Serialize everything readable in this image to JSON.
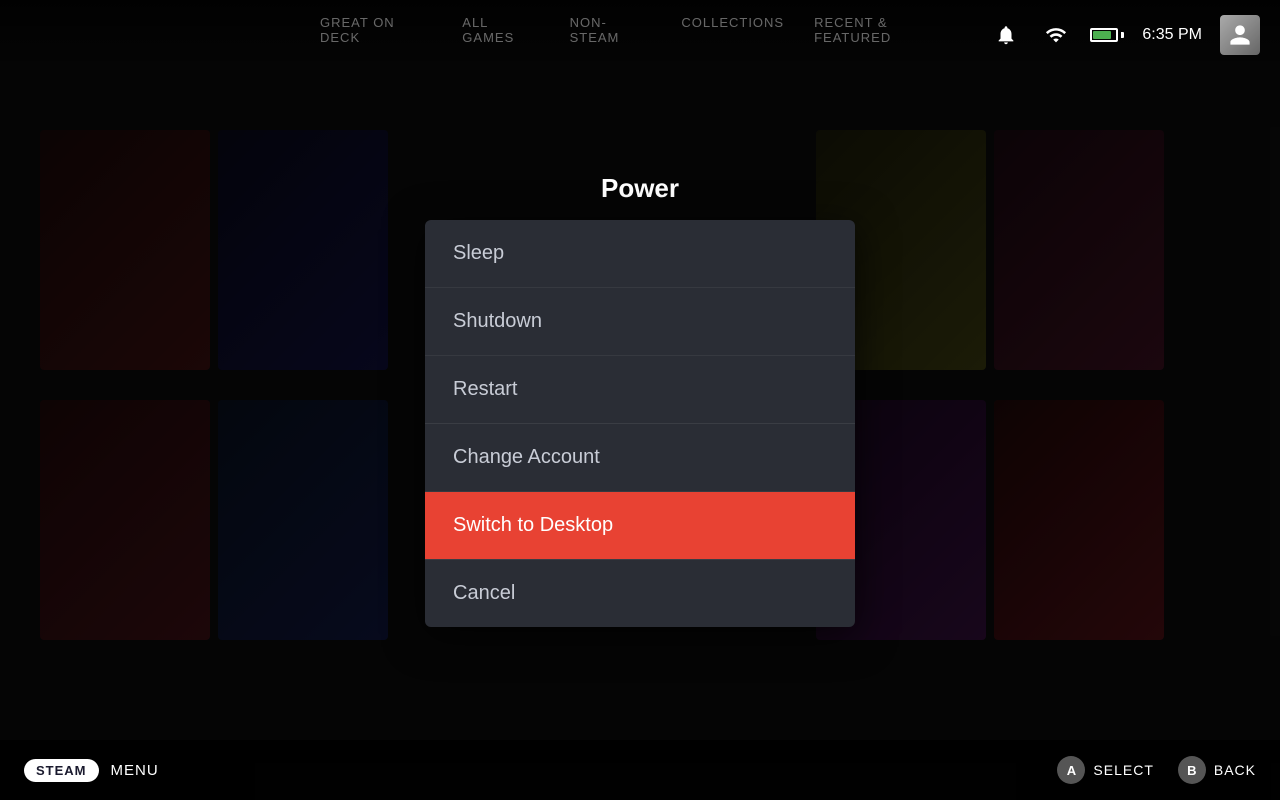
{
  "header": {
    "time": "6:35 PM",
    "title": "Power"
  },
  "nav_tabs": [
    {
      "label": "GREAT ON DECK",
      "active": false
    },
    {
      "label": "ALL GAMES",
      "active": false
    },
    {
      "label": "NON-STEAM",
      "active": false
    },
    {
      "label": "COLLECTIONS",
      "active": false
    },
    {
      "label": "RECENT & FEATURED",
      "active": false
    }
  ],
  "power_menu": {
    "items": [
      {
        "id": "sleep",
        "label": "Sleep",
        "active": false,
        "section": 1
      },
      {
        "id": "shutdown",
        "label": "Shutdown",
        "active": false,
        "section": 1
      },
      {
        "id": "restart",
        "label": "Restart",
        "active": false,
        "section": 1
      },
      {
        "id": "change-account",
        "label": "Change Account",
        "active": false,
        "section": 2
      },
      {
        "id": "switch-to-desktop",
        "label": "Switch to Desktop",
        "active": true,
        "section": 2
      },
      {
        "id": "cancel",
        "label": "Cancel",
        "active": false,
        "section": 3
      }
    ]
  },
  "bottom_bar": {
    "steam_label": "STEAM",
    "menu_label": "MENU",
    "hints": [
      {
        "button": "A",
        "label": "SELECT"
      },
      {
        "button": "B",
        "label": "BACK"
      }
    ]
  },
  "icons": {
    "bell": "🔔",
    "wifi": "📶",
    "user": "👤"
  },
  "colors": {
    "active_item_bg": "#e84233",
    "menu_bg": "#2a2d35",
    "battery_fill": "#4caf50"
  }
}
